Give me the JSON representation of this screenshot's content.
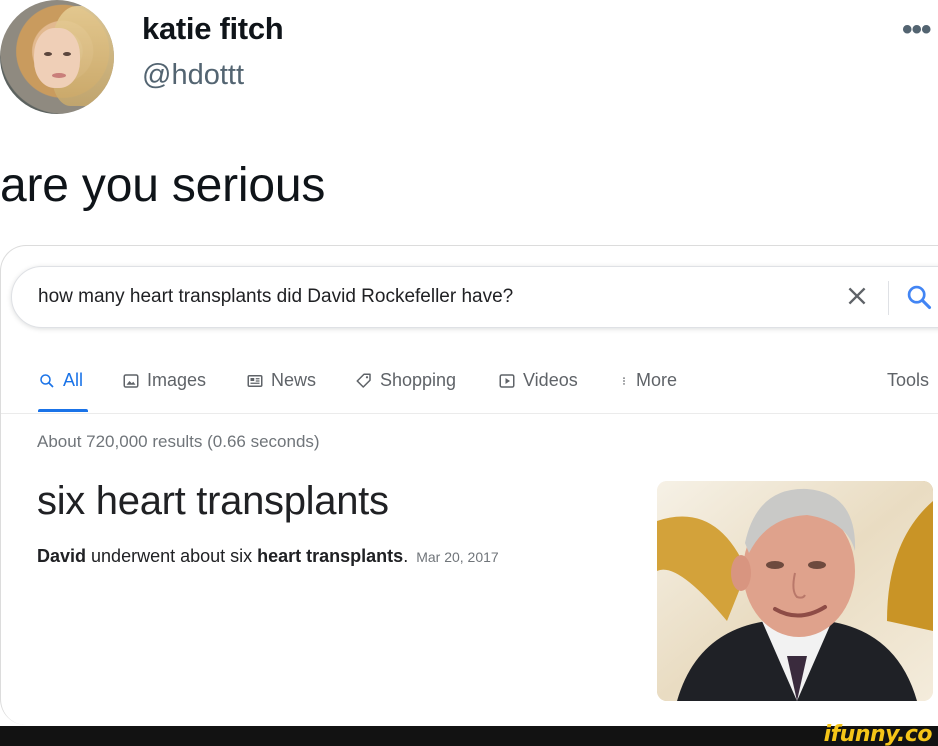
{
  "tweet": {
    "display_name": "katie fitch",
    "handle": "@hdottt",
    "text": "are you serious"
  },
  "google": {
    "query": "how many heart transplants did David Rockefeller have?",
    "tabs": [
      {
        "label": "All",
        "icon": "search-icon",
        "active": true
      },
      {
        "label": "Images",
        "icon": "image-icon"
      },
      {
        "label": "News",
        "icon": "news-icon"
      },
      {
        "label": "Shopping",
        "icon": "tag-icon"
      },
      {
        "label": "Videos",
        "icon": "play-icon"
      },
      {
        "label": "More",
        "icon": "more-vertical-icon"
      }
    ],
    "tools_label": "Tools",
    "stats": "About 720,000 results (0.66 seconds)",
    "answer_title": "six heart transplants",
    "snippet": {
      "part1": "David",
      "part2": " underwent about six ",
      "part3": "heart transplants",
      "part4": ".",
      "date": "Mar 20, 2017"
    }
  },
  "watermark": "ifunny.co",
  "colors": {
    "accent_blue": "#1a73e8",
    "watermark_yellow": "#f5c518"
  }
}
